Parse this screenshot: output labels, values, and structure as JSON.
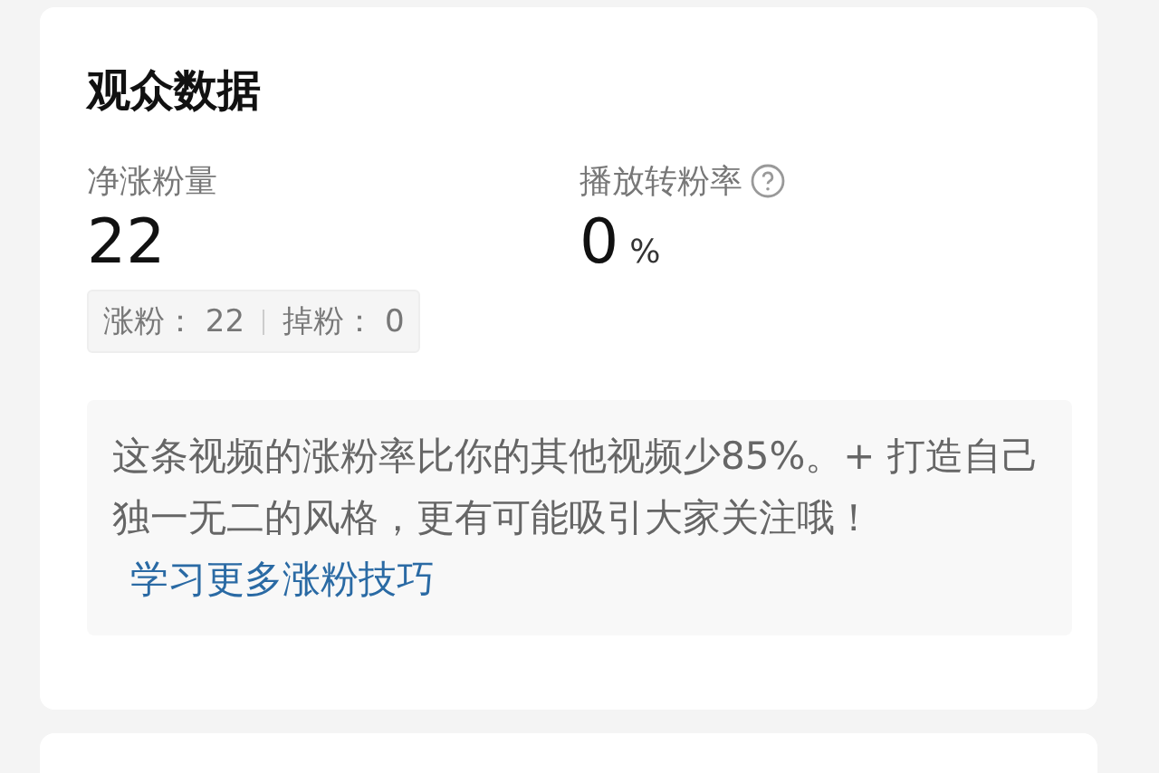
{
  "card": {
    "title": "观众数据",
    "metrics": [
      {
        "label": "净涨粉量",
        "value": "22",
        "help": false
      },
      {
        "label": "播放转粉率",
        "value": "0",
        "unit": "%",
        "help": true
      }
    ],
    "breakdown": [
      {
        "label": "涨粉：",
        "value": "22"
      },
      {
        "label": "掉粉：",
        "value": "0"
      }
    ],
    "tip": {
      "text": "这条视频的涨粉率比你的其他视频少85%。+ 打造自己独一无二的风格，更有可能吸引大家关注哦！",
      "link": "学习更多涨粉技巧"
    }
  }
}
